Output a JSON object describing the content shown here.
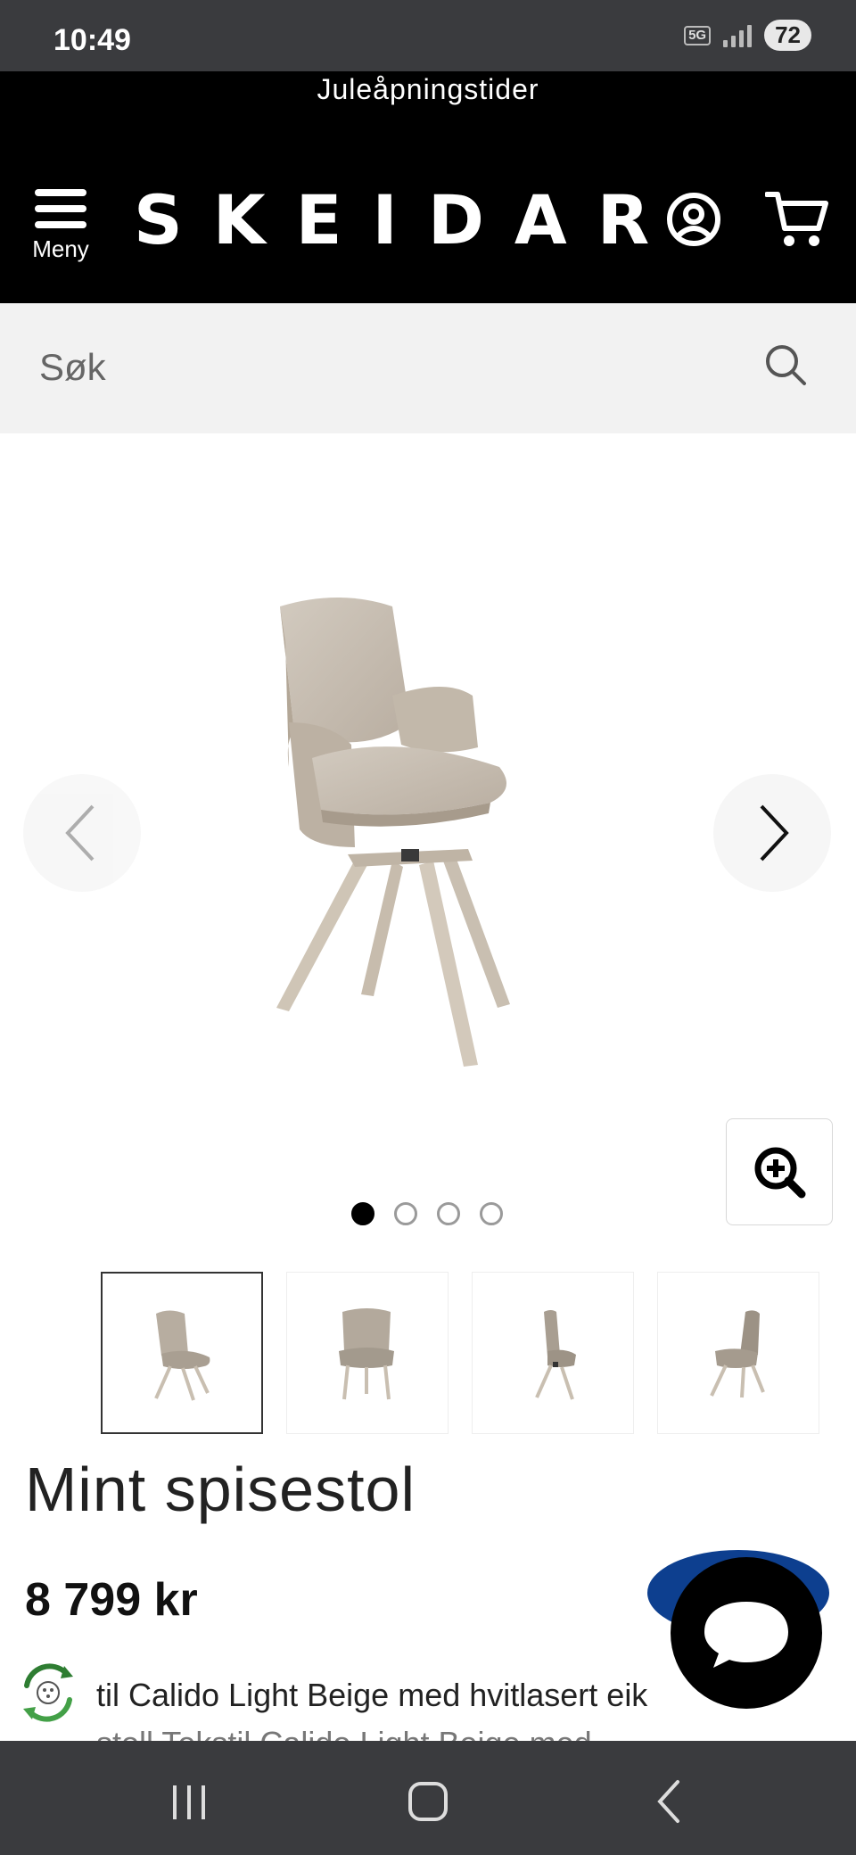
{
  "status_bar": {
    "time": "10:49",
    "network": "5G",
    "battery": "72"
  },
  "header": {
    "promo_text": "Juleåpningstider",
    "menu_label": "Meny",
    "logo": "SKEIDAR",
    "account_icon": "user-circle-icon",
    "cart_icon": "shopping-cart-icon"
  },
  "search": {
    "placeholder": "Søk",
    "icon": "search-icon"
  },
  "gallery": {
    "image_count": 4,
    "active_index": 0,
    "prev_icon": "chevron-left-icon",
    "next_icon": "chevron-right-icon",
    "zoom_icon": "zoom-in-icon"
  },
  "product": {
    "title": "Mint spisestol",
    "price": "8 799 kr",
    "description_line1": "til Calido Light Beige med hvitlasert eik",
    "description_line2": "stoll Tekstil Calido Light Beige med"
  },
  "colors": {
    "header_bg": "#000000",
    "search_bg": "#f2f2f2",
    "chair_upholstery": "#c8bfb3",
    "badge_blue": "#0d3f8f"
  },
  "system_nav": {
    "recents_icon": "recents-icon",
    "home_icon": "home-icon",
    "back_icon": "back-icon"
  }
}
